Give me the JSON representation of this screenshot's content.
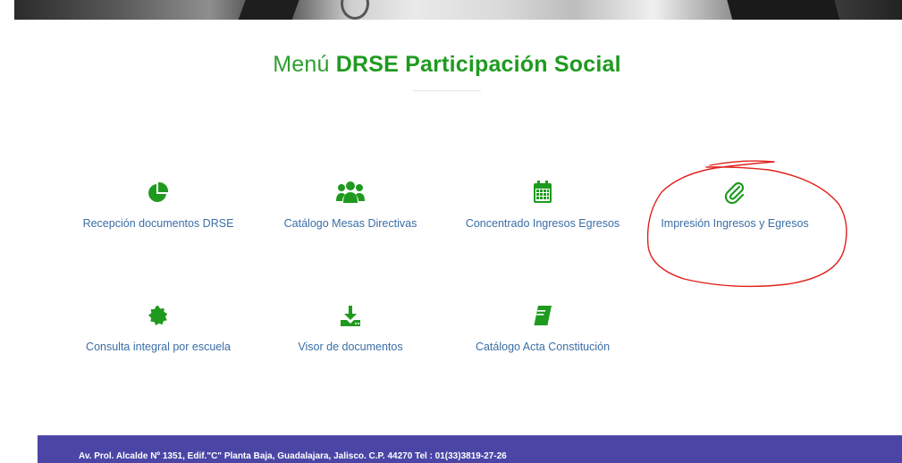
{
  "title": {
    "prefix": "Menú",
    "emphasis": "DRSE Participación Social"
  },
  "menu": {
    "items": [
      {
        "label": "Recepción documentos DRSE",
        "icon": "pie-chart-icon"
      },
      {
        "label": "Catálogo Mesas Directivas",
        "icon": "users-icon"
      },
      {
        "label": "Concentrado Ingresos Egresos",
        "icon": "calendar-icon"
      },
      {
        "label": "Impresión Ingresos y Egresos",
        "icon": "paperclip-icon"
      },
      {
        "label": "Consulta integral por escuela",
        "icon": "certificate-icon"
      },
      {
        "label": "Visor de documentos",
        "icon": "download-icon"
      },
      {
        "label": "Catálogo Acta Constitución",
        "icon": "book-icon"
      }
    ]
  },
  "footer": {
    "address": "Av. Prol. Alcalde Nº 1351, Edif.\"C\" Planta Baja, Guadalajara, Jalisco. C.P. 44270 Tel : 01(33)3819-27-26"
  },
  "colors": {
    "accent": "#1f9a1f",
    "link": "#3a6ea5",
    "footer": "#4b46a6",
    "annotation": "#e0211c"
  }
}
